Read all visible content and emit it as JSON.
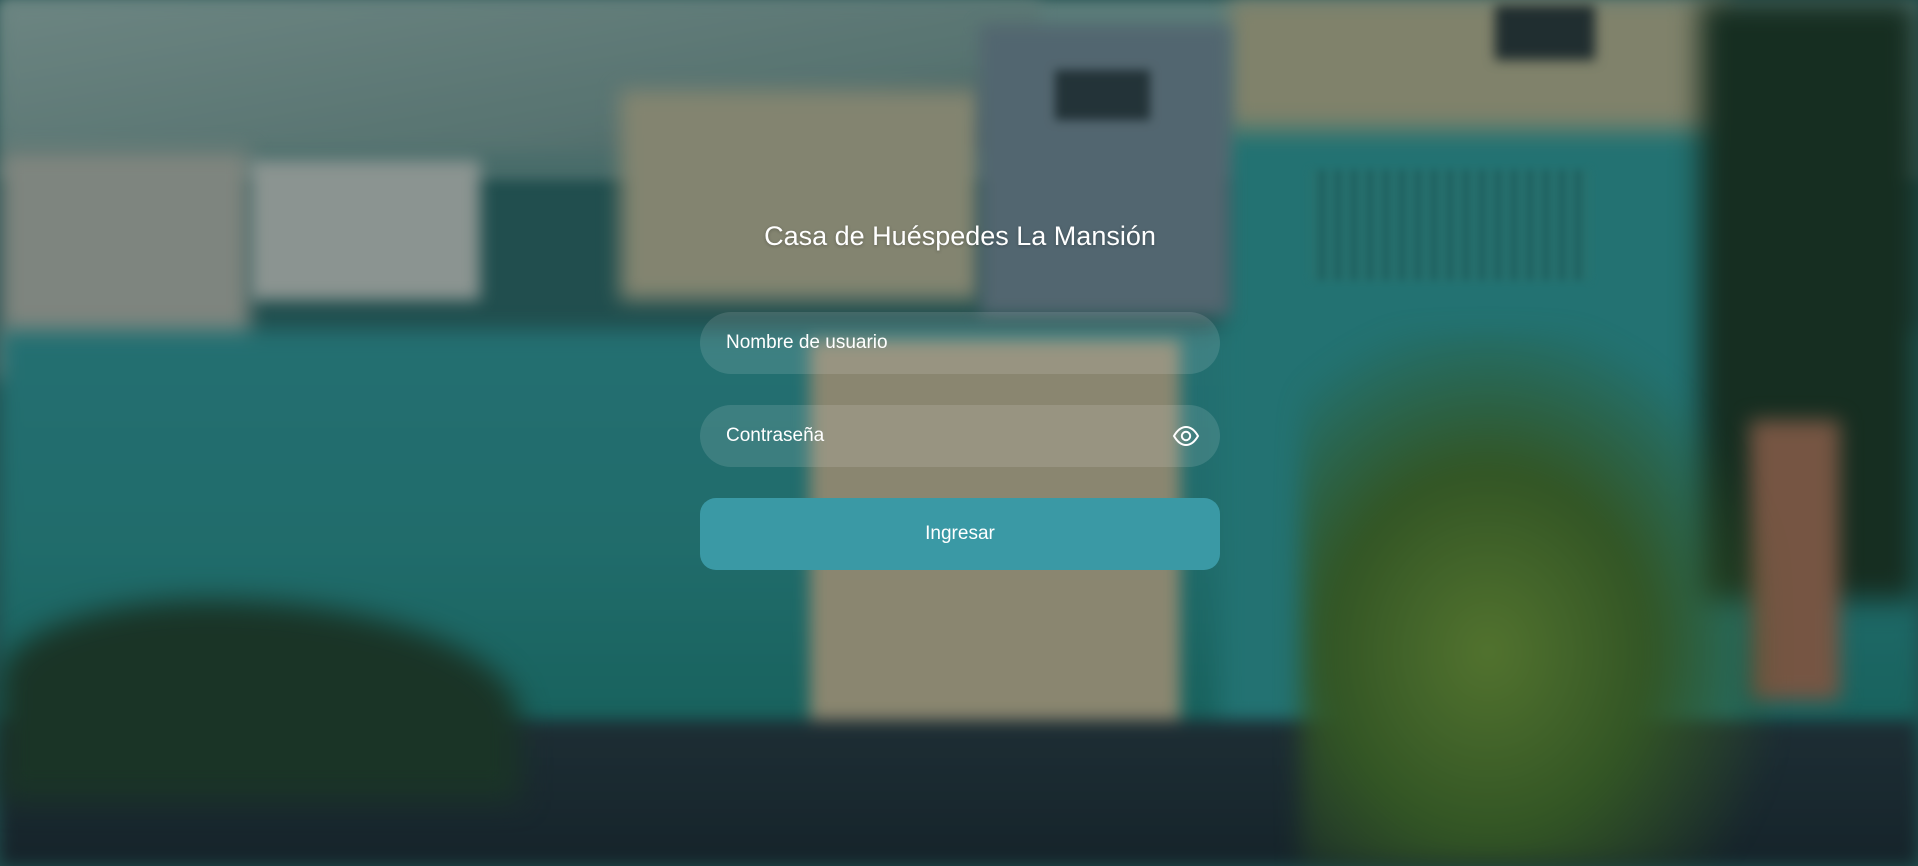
{
  "login": {
    "title": "Casa de Huéspedes La Mansión",
    "username": {
      "placeholder": "Nombre de usuario",
      "value": ""
    },
    "password": {
      "placeholder": "Contraseña",
      "value": "",
      "toggle_icon": "eye-icon"
    },
    "submit_label": "Ingresar"
  },
  "theme": {
    "button_color": "#3a99a5",
    "text_color": "#ffffff"
  }
}
